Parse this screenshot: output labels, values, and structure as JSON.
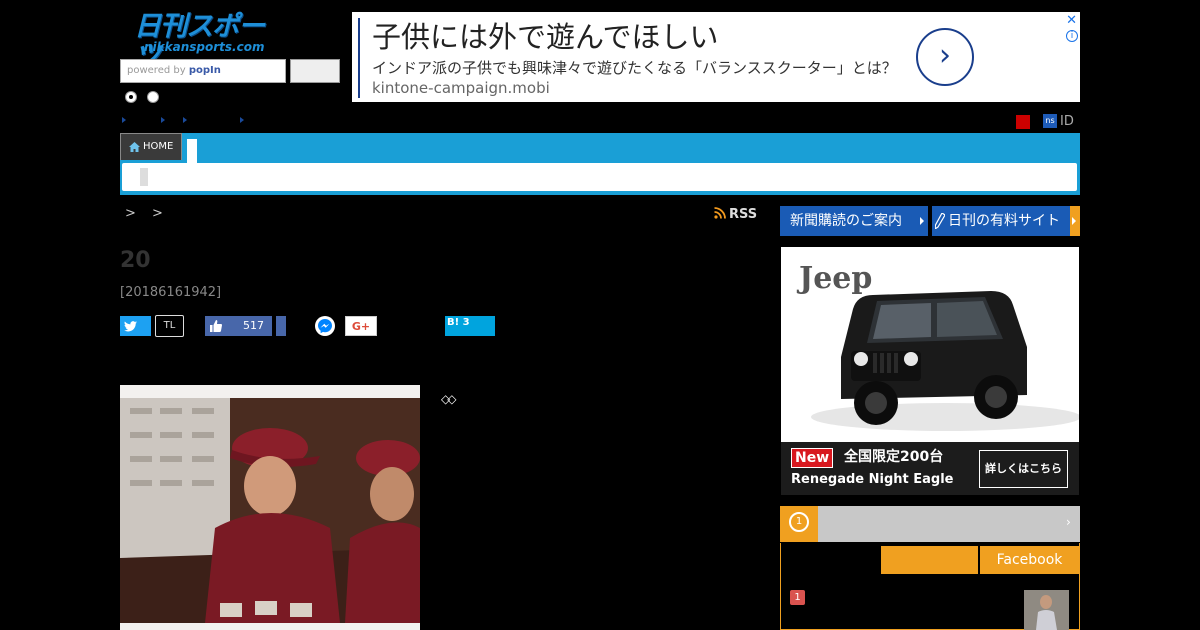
{
  "logo": {
    "main": "日刊スポーツ",
    "sub": "nikkansports.com"
  },
  "search": {
    "placeholder_prefix": "powered by ",
    "provider": "popIn"
  },
  "ad": {
    "title": "子供には外で遊んでほしい",
    "description": "インドア派の子供でも興味津々で遊びたくなる「バランススクーター」とは？",
    "domain": "kintone-campaign.mobi",
    "arrow": "›",
    "close": "✕",
    "info": "i"
  },
  "utility": {
    "ns": "ns",
    "id": "ID"
  },
  "nav": {
    "home": "HOME"
  },
  "breadcrumb": "> >",
  "rss": "RSS",
  "article": {
    "title": "20",
    "date": "[20186161942]"
  },
  "share": {
    "tl": "TL",
    "like_count": "517",
    "gplus": "G+",
    "hatena": "B!",
    "hatena_count": "3"
  },
  "diamonds": "◇◇",
  "sidebar": {
    "subscription": "新聞購読のご案内",
    "paid_site": "日刊の有料サイト",
    "ranking_more": "›",
    "ranking_tab_facebook": "Facebook",
    "rank_number": "1",
    "rank_medal": "1"
  },
  "jeep_ad": {
    "logo": "Jeep",
    "new": "New",
    "limited": "全国限定200台",
    "model": "Renegade Night Eagle",
    "cta": "詳しくはこちら"
  },
  "colors": {
    "nav": "#1a9fd6",
    "accent": "#f0a020",
    "brand_blue": "#1a5bb5"
  }
}
